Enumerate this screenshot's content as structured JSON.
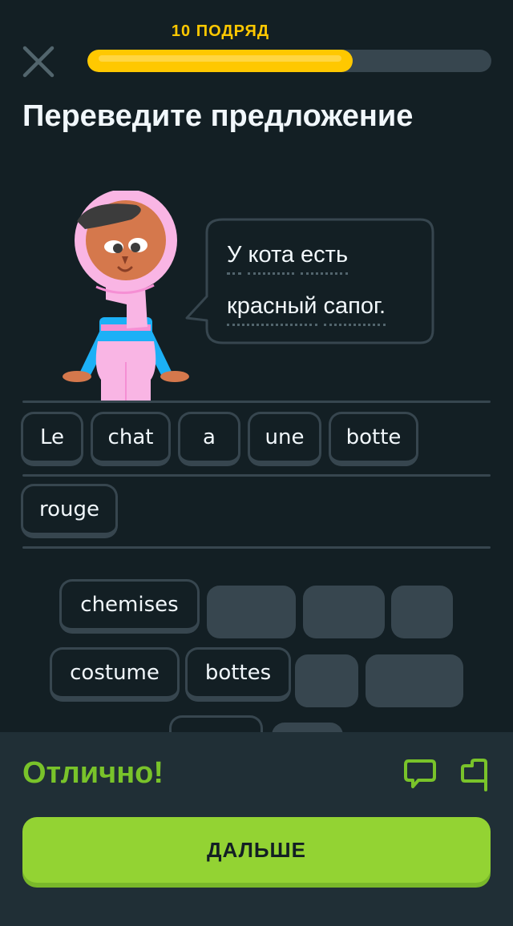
{
  "header": {
    "streak_label": "10 ПОДРЯД",
    "progress_fraction": 0.657,
    "close_icon": "close-icon"
  },
  "title": "Переведите предложение",
  "prompt": {
    "line1": [
      "У",
      "кота",
      "есть"
    ],
    "line2": [
      "красный",
      "сапог."
    ]
  },
  "answer": {
    "tiles": [
      "Le",
      "chat",
      "a",
      "une",
      "botte",
      "rouge"
    ]
  },
  "word_bank": {
    "row1": [
      {
        "label": "chemises",
        "state": "available"
      },
      {
        "label": "",
        "state": "used"
      },
      {
        "label": "",
        "state": "used"
      },
      {
        "label": "",
        "state": "used"
      }
    ],
    "row2": [
      {
        "label": "costume",
        "state": "available"
      },
      {
        "label": "bottes",
        "state": "available"
      },
      {
        "label": "",
        "state": "used"
      },
      {
        "label": "",
        "state": "used"
      }
    ],
    "row3": [
      {
        "label": "",
        "state": "available"
      },
      {
        "label": "",
        "state": "used"
      }
    ]
  },
  "footer": {
    "feedback": "Отлично!",
    "comment_icon": "comment-icon",
    "report_icon": "flag-icon",
    "continue_label": "ДАЛЬШЕ"
  },
  "colors": {
    "background": "#131f24",
    "streak": "#ffc800",
    "success": "#79c32a",
    "button": "#93d333",
    "tile_border": "#37464f"
  }
}
